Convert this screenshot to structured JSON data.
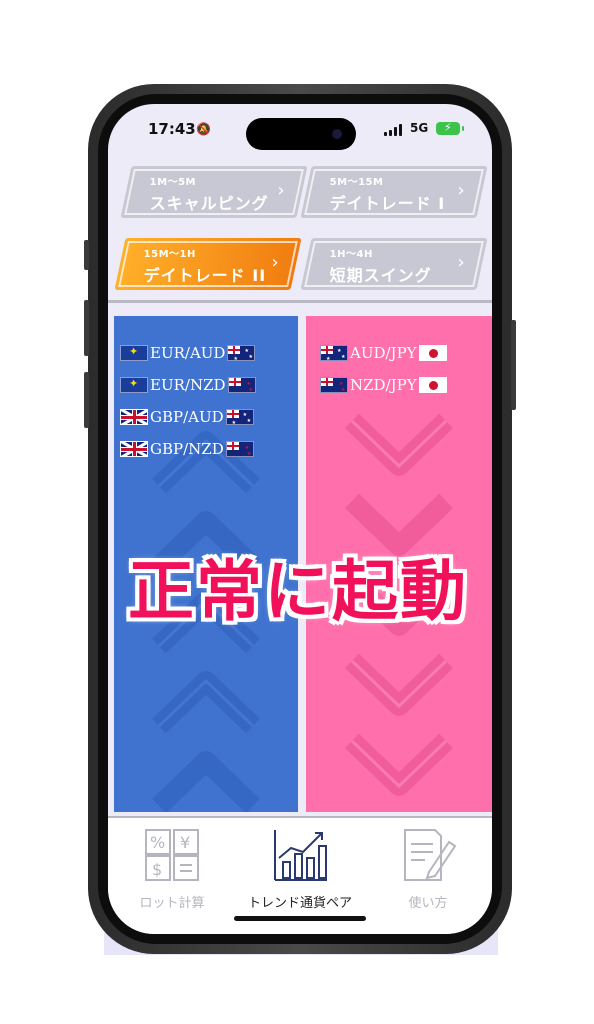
{
  "status_bar": {
    "time": "17:43",
    "network": "5G"
  },
  "modes": [
    {
      "range": "1M〜5M",
      "label": "スキャルピング",
      "active": false
    },
    {
      "range": "5M〜15M",
      "label": "デイトレード I",
      "active": false
    },
    {
      "range": "15M〜1H",
      "label": "デイトレード II",
      "active": true
    },
    {
      "range": "1H〜4H",
      "label": "短期スイング",
      "active": false
    }
  ],
  "uptrend_pairs": [
    {
      "pair": "EUR/AUD",
      "base_flag": "eu-flag-icon",
      "quote_flag": "au-flag-icon"
    },
    {
      "pair": "EUR/NZD",
      "base_flag": "eu-flag-icon",
      "quote_flag": "nz-flag-icon"
    },
    {
      "pair": "GBP/AUD",
      "base_flag": "gb-flag-icon",
      "quote_flag": "au-flag-icon"
    },
    {
      "pair": "GBP/NZD",
      "base_flag": "gb-flag-icon",
      "quote_flag": "nz-flag-icon"
    }
  ],
  "downtrend_pairs": [
    {
      "pair": "AUD/JPY",
      "base_flag": "au-flag-icon",
      "quote_flag": "jp-flag-icon"
    },
    {
      "pair": "NZD/JPY",
      "base_flag": "nz-flag-icon",
      "quote_flag": "jp-flag-icon"
    }
  ],
  "caption": "正常に起動",
  "tabs": [
    {
      "label": "ロット計算",
      "icon": "calculator-icon",
      "active": false
    },
    {
      "label": "トレンド通貨ペア",
      "icon": "trend-chart-icon",
      "active": true
    },
    {
      "label": "使い方",
      "icon": "document-pen-icon",
      "active": false
    }
  ],
  "colors": {
    "uptrend": "#3f73cf",
    "downtrend": "#ff6fab",
    "active_mode": "#f58f1a",
    "caption": "#f1115a"
  }
}
